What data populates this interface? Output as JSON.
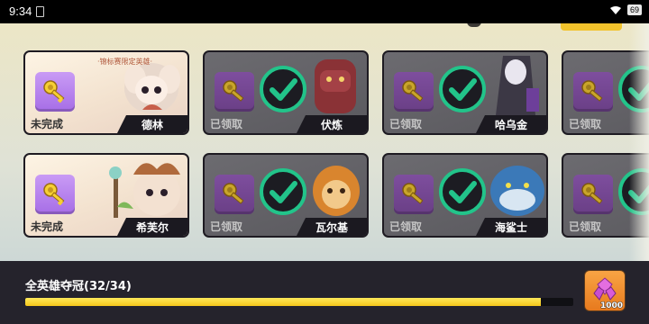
{
  "status_bar": {
    "time": "9:34",
    "battery": "69"
  },
  "cards": [
    {
      "status": "未完成",
      "hero": "德林",
      "claimed": false,
      "tag": "·锦标赛限定英雄·"
    },
    {
      "status": "已领取",
      "hero": "伏炼",
      "claimed": true
    },
    {
      "status": "已领取",
      "hero": "哈乌金",
      "claimed": true
    },
    {
      "status": "已领取",
      "hero": "",
      "claimed": true
    },
    {
      "status": "未完成",
      "hero": "希芙尔",
      "claimed": false
    },
    {
      "status": "已领取",
      "hero": "瓦尔基",
      "claimed": true
    },
    {
      "status": "已领取",
      "hero": "海鲨士",
      "claimed": true
    },
    {
      "status": "已领取",
      "hero": "",
      "claimed": true
    }
  ],
  "progress": {
    "title": "全英雄夺冠(32/34)",
    "current": 32,
    "total": 34
  },
  "reward": {
    "count": "1000",
    "icon": "gem-cluster-icon"
  },
  "colors": {
    "accent_yellow": "#f5c61a",
    "key_purple": "#a66de6",
    "check_green": "#22c48a",
    "reward_orange": "#e77a1e"
  }
}
